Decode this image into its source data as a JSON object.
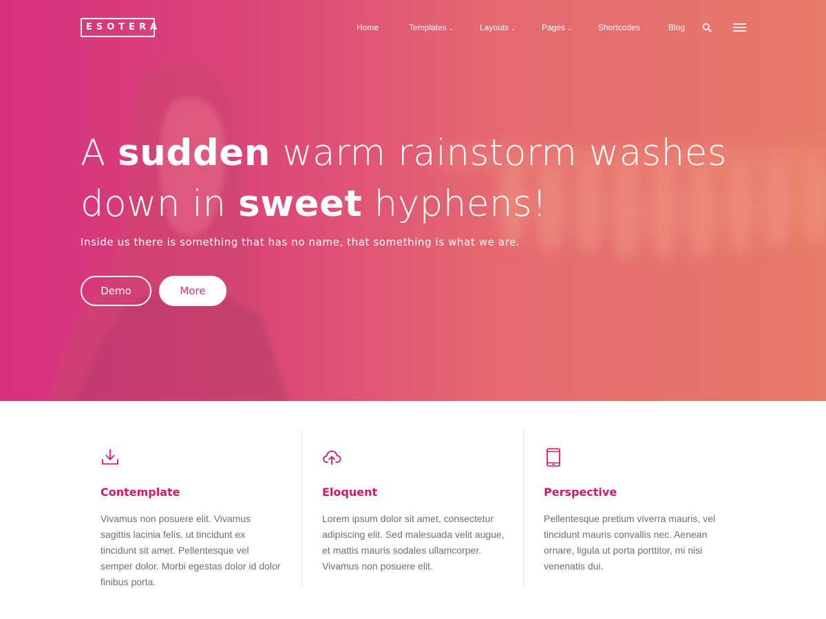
{
  "brand": {
    "logo_text": "ESOTERA",
    "accent_color": "#d1186e"
  },
  "nav": {
    "items": [
      {
        "label": "Home",
        "has_dropdown": false
      },
      {
        "label": "Templates",
        "has_dropdown": true
      },
      {
        "label": "Layouts",
        "has_dropdown": true
      },
      {
        "label": "Pages",
        "has_dropdown": true
      },
      {
        "label": "Shortcodes",
        "has_dropdown": false
      },
      {
        "label": "Blog",
        "has_dropdown": false
      }
    ],
    "search_icon": "search-icon",
    "menu_icon": "hamburger-menu-icon"
  },
  "hero": {
    "headline": {
      "w1": "A",
      "w2": "sudden",
      "w3": "warm rainstorm washes",
      "w4": "down in",
      "w5": "sweet",
      "w6": "hyphens!"
    },
    "subtitle": "Inside us there is something that has no name, that something is what we are.",
    "buttons": {
      "demo_label": "Demo",
      "more_label": "More"
    },
    "gradient_colors": [
      "#d6307f",
      "#e87a68"
    ]
  },
  "features": [
    {
      "icon": "download-icon",
      "title": "Contemplate",
      "text": "Vivamus non posuere elit. Vivamus sagittis lacinia felis, ut tincidunt ex tincidunt sit amet. Pellentesque vel semper dolor. Morbi egestas dolor id dolor finibus porta."
    },
    {
      "icon": "cloud-upload-icon",
      "title": "Eloquent",
      "text": "Lorem ipsum dolor sit amet, consectetur adipiscing elit. Sed malesuada velit augue, et mattis mauris sodales ullamcorper. Vivamus non posuere elit."
    },
    {
      "icon": "mobile-phone-icon",
      "title": "Perspective",
      "text": "Pellentesque pretium viverra mauris, vel tincidunt mauris convallis nec. Aenean ornare, ligula ut porta porttitor, mi nisi venenatis dui."
    }
  ]
}
